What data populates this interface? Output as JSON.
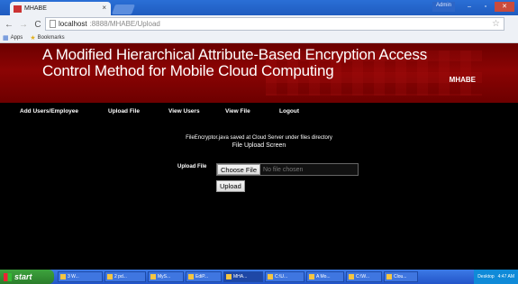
{
  "browser": {
    "tab_title": "MHABE",
    "tab_close": "×",
    "user_label": "Admin",
    "back": "←",
    "forward": "→",
    "reload": "C",
    "url_host": "localhost",
    "url_rest": ":8888/MHABE/Upload",
    "bookmarks": {
      "apps": "Apps",
      "bookmarks": "Bookmarks"
    }
  },
  "site": {
    "title": "A Modified Hierarchical Attribute-Based Encryption Access Control Method for Mobile Cloud Computing",
    "subtitle": "MHABE"
  },
  "nav": {
    "items": [
      "Add Users/Employee",
      "Upload File",
      "View Users",
      "View File",
      "Logout"
    ]
  },
  "content": {
    "message": "FileEncryptor.java saved at Cloud Server under files directory",
    "heading": "File Upload Screen",
    "upload_label": "Upload File",
    "choose_button": "Choose File",
    "file_status": "No file chosen",
    "upload_button": "Upload"
  },
  "taskbar": {
    "start": "start",
    "tasks": [
      "3 W...",
      "2 pd...",
      "MyS...",
      "EdiP...",
      "MHA...",
      "C:\\U...",
      "A Mo...",
      "C:\\W...",
      "Clou..."
    ],
    "tray_label": "Desktop",
    "clock": "4:47 AM"
  }
}
